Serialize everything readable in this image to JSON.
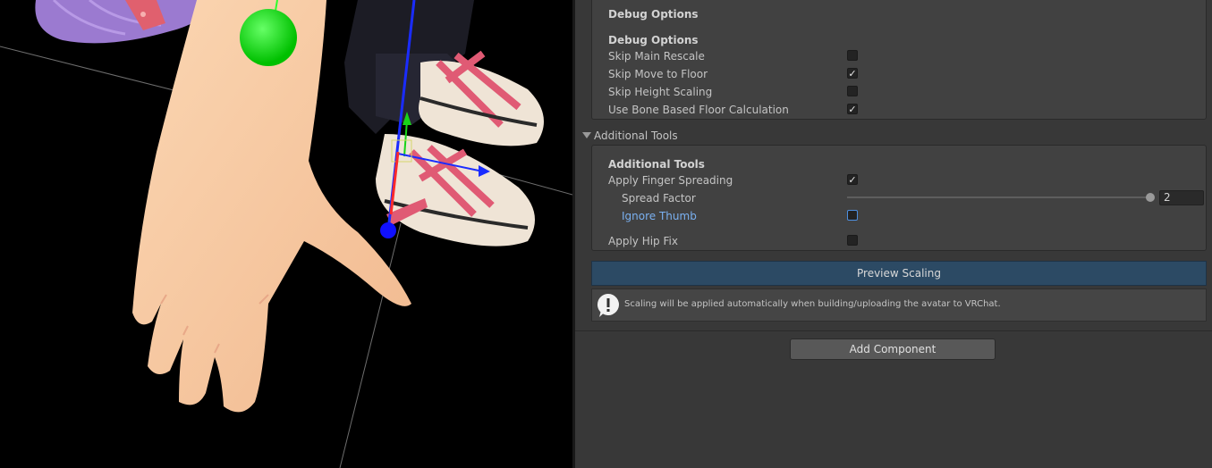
{
  "debug": {
    "header": "Debug Options",
    "title": "Debug Options",
    "items": [
      {
        "label": "Skip Main Rescale",
        "checked": false
      },
      {
        "label": "Skip Move to Floor",
        "checked": true
      },
      {
        "label": "Skip Height Scaling",
        "checked": false
      },
      {
        "label": "Use Bone Based Floor Calculation",
        "checked": true
      }
    ]
  },
  "additional": {
    "foldout": "Additional Tools",
    "title": "Additional Tools",
    "finger": {
      "label": "Apply Finger Spreading",
      "checked": true
    },
    "spread": {
      "label": "Spread Factor",
      "value": "2",
      "fraction": 1.0
    },
    "thumb": {
      "label": "Ignore Thumb",
      "checked": false
    },
    "hip": {
      "label": "Apply Hip Fix",
      "checked": false
    }
  },
  "preview_button": "Preview Scaling",
  "help": {
    "text": "Scaling will be applied automatically when building/uploading the avatar to VRChat.",
    "icon": "info-icon"
  },
  "add_component": "Add Component",
  "scene": {
    "description_icon": "scene-view"
  },
  "colors": {
    "accent_blue": "#7ab0f0",
    "preview_bg": "#2c4a64",
    "panel_bg": "#383838"
  }
}
